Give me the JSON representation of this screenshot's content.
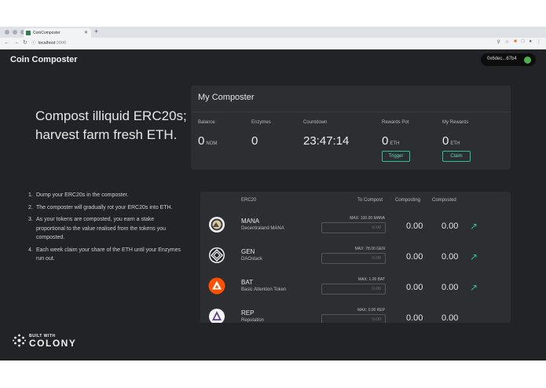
{
  "browser": {
    "tab_title": "CoinComposter",
    "url_host": "localhost",
    "url_port": ":3000"
  },
  "app": {
    "title": "Coin Composter",
    "wallet_address": "0x6dec...67b4",
    "hero_line1": "Compost illiquid ERC20s;",
    "hero_line2": "harvest farm fresh ETH."
  },
  "composter": {
    "title": "My Composter",
    "balance": {
      "label": "Balance",
      "value": "0",
      "unit": "NOM"
    },
    "enzymes": {
      "label": "Enzymes",
      "value": "0"
    },
    "countdown": {
      "label": "Countdown",
      "value": "23:47:14"
    },
    "rewards_pot": {
      "label": "Rewards Pot",
      "value": "0",
      "unit": "ETH",
      "button": "Trigger"
    },
    "my_rewards": {
      "label": "My Rewards",
      "value": "0",
      "unit": "ETH",
      "button": "Claim"
    }
  },
  "steps": [
    {
      "num": "1.",
      "text": "Dump your ERC20s in the composter."
    },
    {
      "num": "2.",
      "text": "The composter will gradually rot your ERC20s into ETH."
    },
    {
      "num": "3.",
      "text": "As your tokens are composted, you earn a stake proportional to the value realised from the tokens you composted."
    },
    {
      "num": "4.",
      "text": "Each week claim your share of the ETH until your Enzymes run out."
    }
  ],
  "table": {
    "headers": {
      "erc20": "ERC20",
      "to_compost": "To Compost",
      "composting": "Composting",
      "composted": "Composted"
    },
    "rows": [
      {
        "symbol": "MANA",
        "name": "Decentraland MANA",
        "max": "MAX: 100.00 MANA",
        "placeholder": "0.00",
        "composting": "0.00",
        "composted": "0.00",
        "color": "#f5f5f5"
      },
      {
        "symbol": "GEN",
        "name": "DAOstack",
        "max": "MAX: 78.00 GEN",
        "placeholder": "0.00",
        "composting": "0.00",
        "composted": "0.00",
        "color": "#f5f5f5"
      },
      {
        "symbol": "BAT",
        "name": "Basic Attention Token",
        "max": "MAX: 1.00 BAT",
        "placeholder": "0.00",
        "composting": "0.00",
        "composted": "0.00",
        "color": "#ff5000"
      },
      {
        "symbol": "REP",
        "name": "Reputation",
        "max": "MAX: 0.00 REP",
        "placeholder": "0.00",
        "composting": "0.00",
        "composted": "0.00",
        "color": "#f5f5f5"
      }
    ]
  },
  "footer": {
    "built_with": "BUILT WITH",
    "brand": "COLONY"
  },
  "colors": {
    "background": "#222326",
    "card": "#2d2e32",
    "accent": "#2bbf9a"
  }
}
